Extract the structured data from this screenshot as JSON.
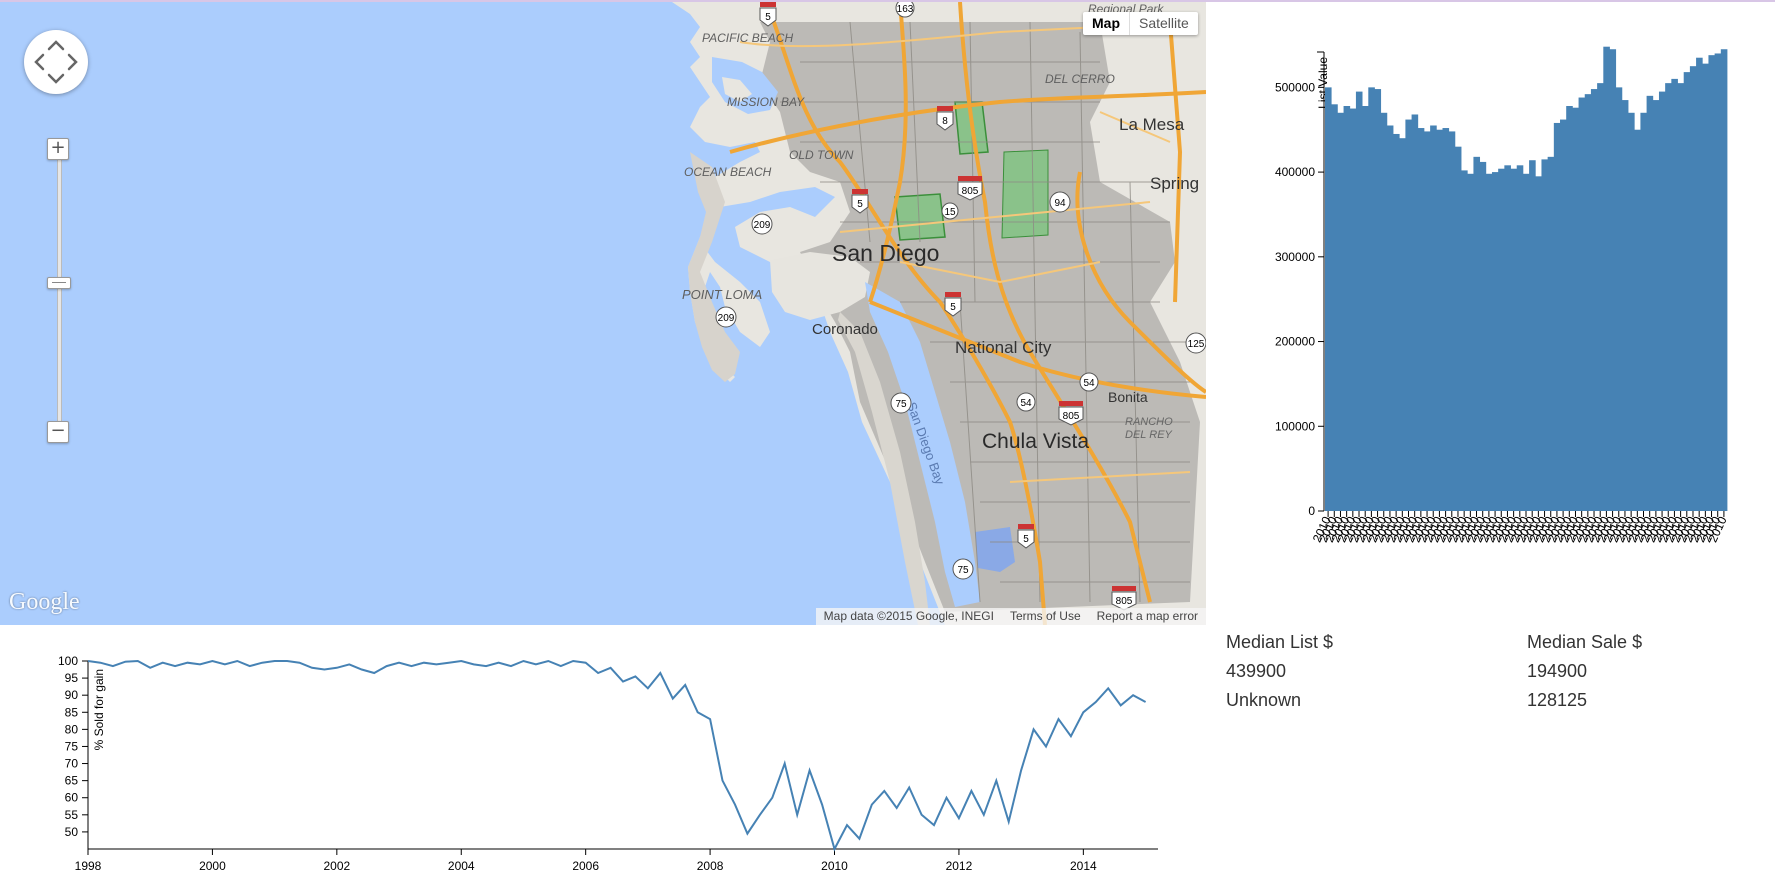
{
  "map": {
    "type_buttons": [
      "Map",
      "Satellite"
    ],
    "zoom_in": "+",
    "zoom_out": "−",
    "google_logo": "Google",
    "attribution": [
      "Map data ©2015 Google, INEGI",
      "Terms of Use",
      "Report a map error"
    ],
    "labels": {
      "san_diego": "San Diego",
      "la_mesa": "La Mesa",
      "spring": "Spring",
      "national_city": "National City",
      "chula_vista": "Chula Vista",
      "coronado": "Coronado",
      "bonita": "Bonita",
      "san_diego_bay": "San Diego Bay",
      "pacific_beach": "PACIFIC BEACH",
      "mission_bay": "MISSION BAY",
      "old_town": "OLD TOWN",
      "ocean_beach": "OCEAN BEACH",
      "point_loma": "POINT LOMA",
      "del_cerro": "DEL CERRO",
      "regional_park": "Regional Park",
      "rancho_del_rey": "RANCHO DEL REY"
    },
    "shields": [
      "5",
      "805",
      "94",
      "15",
      "209",
      "75",
      "54",
      "125",
      "163",
      "8"
    ]
  },
  "stats": {
    "headers": [
      "Median List $",
      "Median Sale $"
    ],
    "rows": [
      [
        "439900",
        "194900"
      ],
      [
        "Unknown",
        "128125"
      ]
    ]
  },
  "chart_data": [
    {
      "type": "bar",
      "ylabel": "List Value",
      "ylim": [
        0,
        550000
      ],
      "yticks": [
        0,
        100000,
        200000,
        300000,
        400000,
        500000
      ],
      "x_tick_label": "2010",
      "values": [
        500000,
        480000,
        470000,
        478000,
        475000,
        495000,
        478000,
        500000,
        498000,
        470000,
        455000,
        445000,
        440000,
        462000,
        468000,
        452000,
        448000,
        455000,
        450000,
        452000,
        448000,
        430000,
        402000,
        398000,
        418000,
        412000,
        398000,
        400000,
        404000,
        408000,
        404000,
        408000,
        398000,
        414000,
        395000,
        415000,
        418000,
        458000,
        462000,
        478000,
        476000,
        488000,
        492000,
        498000,
        505000,
        548000,
        545000,
        500000,
        485000,
        470000,
        450000,
        470000,
        490000,
        485000,
        495000,
        505000,
        510000,
        505000,
        518000,
        525000,
        535000,
        528000,
        538000,
        540000,
        545000
      ]
    },
    {
      "type": "line",
      "ylabel": "% Sold for gain",
      "ylim": [
        45,
        100
      ],
      "yticks": [
        50,
        55,
        60,
        65,
        70,
        75,
        80,
        85,
        90,
        95,
        100
      ],
      "xlim": [
        1998,
        2015.2
      ],
      "xticks": [
        1998,
        2000,
        2002,
        2004,
        2006,
        2008,
        2010,
        2012,
        2014
      ],
      "points": [
        [
          1998.0,
          100
        ],
        [
          1998.2,
          99.5
        ],
        [
          1998.4,
          98.5
        ],
        [
          1998.6,
          99.8
        ],
        [
          1998.8,
          100
        ],
        [
          1999.0,
          98
        ],
        [
          1999.2,
          99.5
        ],
        [
          1999.4,
          98.5
        ],
        [
          1999.6,
          99.5
        ],
        [
          1999.8,
          99
        ],
        [
          2000.0,
          100
        ],
        [
          2000.2,
          99
        ],
        [
          2000.4,
          100
        ],
        [
          2000.6,
          98.5
        ],
        [
          2000.8,
          99.5
        ],
        [
          2001.0,
          100
        ],
        [
          2001.2,
          100
        ],
        [
          2001.4,
          99.5
        ],
        [
          2001.6,
          98
        ],
        [
          2001.8,
          97.5
        ],
        [
          2002.0,
          98
        ],
        [
          2002.2,
          99
        ],
        [
          2002.4,
          97.5
        ],
        [
          2002.6,
          96.5
        ],
        [
          2002.8,
          98.5
        ],
        [
          2003.0,
          99.5
        ],
        [
          2003.2,
          98.5
        ],
        [
          2003.4,
          99.5
        ],
        [
          2003.6,
          99
        ],
        [
          2003.8,
          99.5
        ],
        [
          2004.0,
          100
        ],
        [
          2004.2,
          99
        ],
        [
          2004.4,
          98.5
        ],
        [
          2004.6,
          99.5
        ],
        [
          2004.8,
          98.5
        ],
        [
          2005.0,
          100
        ],
        [
          2005.2,
          99
        ],
        [
          2005.4,
          100
        ],
        [
          2005.6,
          98.5
        ],
        [
          2005.8,
          100
        ],
        [
          2006.0,
          99.5
        ],
        [
          2006.2,
          96.5
        ],
        [
          2006.4,
          98
        ],
        [
          2006.6,
          94
        ],
        [
          2006.8,
          95.5
        ],
        [
          2007.0,
          92
        ],
        [
          2007.2,
          96.5
        ],
        [
          2007.4,
          89
        ],
        [
          2007.6,
          93
        ],
        [
          2007.8,
          85
        ],
        [
          2008.0,
          83
        ],
        [
          2008.2,
          65
        ],
        [
          2008.4,
          58
        ],
        [
          2008.6,
          49.5
        ],
        [
          2008.8,
          55
        ],
        [
          2009.0,
          60
        ],
        [
          2009.2,
          70
        ],
        [
          2009.4,
          55
        ],
        [
          2009.6,
          68
        ],
        [
          2009.8,
          58
        ],
        [
          2010.0,
          45
        ],
        [
          2010.2,
          52
        ],
        [
          2010.4,
          48
        ],
        [
          2010.6,
          58
        ],
        [
          2010.8,
          62
        ],
        [
          2011.0,
          57
        ],
        [
          2011.2,
          63
        ],
        [
          2011.4,
          55
        ],
        [
          2011.6,
          52
        ],
        [
          2011.8,
          60
        ],
        [
          2012.0,
          54
        ],
        [
          2012.2,
          62
        ],
        [
          2012.4,
          55
        ],
        [
          2012.6,
          65
        ],
        [
          2012.8,
          53
        ],
        [
          2013.0,
          68
        ],
        [
          2013.2,
          80
        ],
        [
          2013.4,
          75
        ],
        [
          2013.6,
          83
        ],
        [
          2013.8,
          78
        ],
        [
          2014.0,
          85
        ],
        [
          2014.2,
          88
        ],
        [
          2014.4,
          92
        ],
        [
          2014.6,
          87
        ],
        [
          2014.8,
          90
        ],
        [
          2015.0,
          88
        ]
      ]
    }
  ]
}
